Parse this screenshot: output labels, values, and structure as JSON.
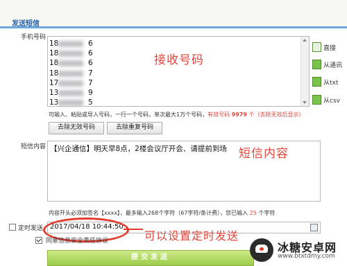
{
  "header": {
    "title": "发送短信"
  },
  "phone_section": {
    "label": "手机号码",
    "numbers": [
      "18",
      "18",
      "18",
      "18",
      "17",
      "13",
      "13"
    ],
    "number_suffixes": [
      "6",
      "6",
      "6",
      "7",
      "7",
      "9",
      "5"
    ],
    "hint_prefix": "可输入、粘贴或导入号码，一行一个号码，单次最大1万个号码，",
    "hint_valid_label": "有效号码",
    "hint_valid_count": "9979",
    "hint_valid_unit": "个",
    "hint_suffix": "（去除无效后显示）",
    "remove_invalid_label": "去除无效号码",
    "remove_duplicate_label": "去除重复号码"
  },
  "side_actions": [
    {
      "label": "直接",
      "icon": "spreadsheet-icon"
    },
    {
      "label": "从通讯",
      "icon": "contacts-icon"
    },
    {
      "label": "从txt",
      "icon": "txt-import-icon"
    },
    {
      "label": "从csv",
      "icon": "csv-import-icon"
    }
  ],
  "message_section": {
    "label": "短信内容",
    "content": "【兴企通信】明天早8点，2楼会议厅开会、请提前到场",
    "hint_prefix": "内容开头必须加签名【xxxx】，最多输入268个字符（67字符/条计费），您已输入",
    "hint_count": "25",
    "hint_unit": "个字符"
  },
  "schedule": {
    "label": "定时发送",
    "datetime": "2017/04/18 10:44:50",
    "checked": false
  },
  "agreement": {
    "label": "同意信息安全责任协议",
    "checked": true
  },
  "send_button": {
    "label": "提交发送"
  },
  "annotations": {
    "receive_number": "接收号码",
    "message_content": "短信内容",
    "schedule_note": "可以设置定时发送"
  },
  "watermark": {
    "name": "冰糖安卓网",
    "url": "www.btxtdmy.com"
  },
  "colors": {
    "accent": "#1f5fa6",
    "annotation_red": "#e0463b",
    "send_green": "#9ccc4c"
  }
}
